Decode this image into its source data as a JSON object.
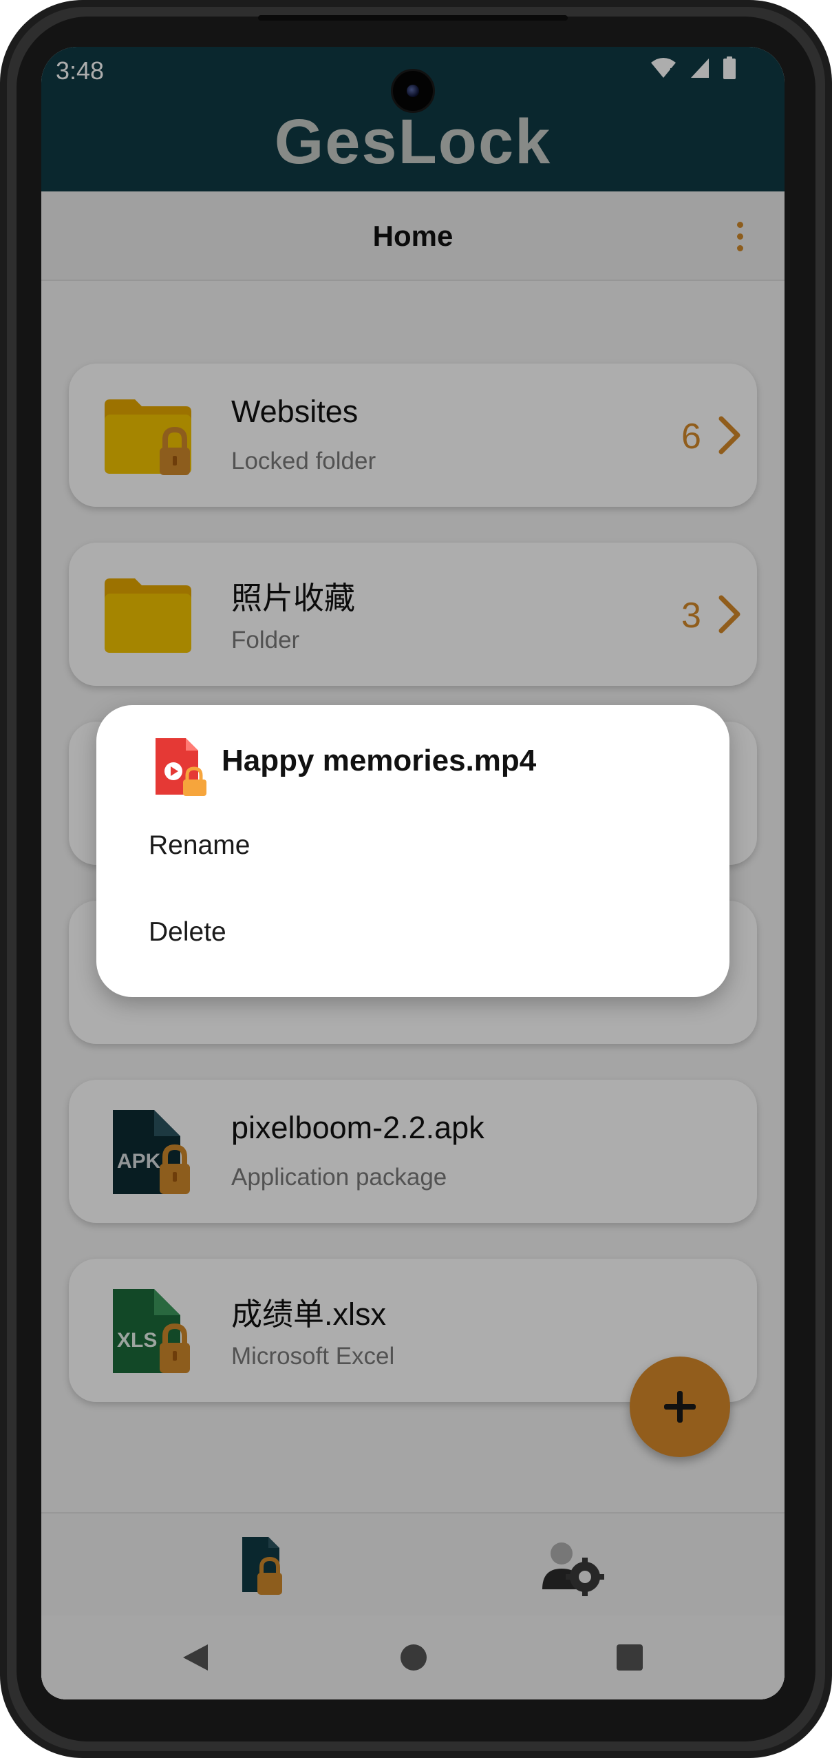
{
  "status_bar": {
    "time": "3:48"
  },
  "app_bar": {
    "logo_text": "GesLock"
  },
  "title_bar": {
    "title": "Home"
  },
  "items": [
    {
      "name": "Websites",
      "subtitle": "Locked folder",
      "count": "6"
    },
    {
      "name": "照片收藏",
      "subtitle": "Folder",
      "count": "3"
    },
    {
      "name": "pixelboom-2.2.apk",
      "subtitle": "Application package",
      "icon_text": "APK"
    },
    {
      "name": "成绩单.xlsx",
      "subtitle": "Microsoft Excel",
      "icon_text": "XLS"
    }
  ],
  "dialog": {
    "title": "Happy memories.mp4",
    "options": [
      "Rename",
      "Delete"
    ]
  },
  "colors": {
    "app_bar": "#0f3a44",
    "accent": "#d88a2a",
    "folder": "#f2c200",
    "video": "#e53935",
    "apk": "#0d2b33",
    "excel": "#1b6b3a"
  }
}
